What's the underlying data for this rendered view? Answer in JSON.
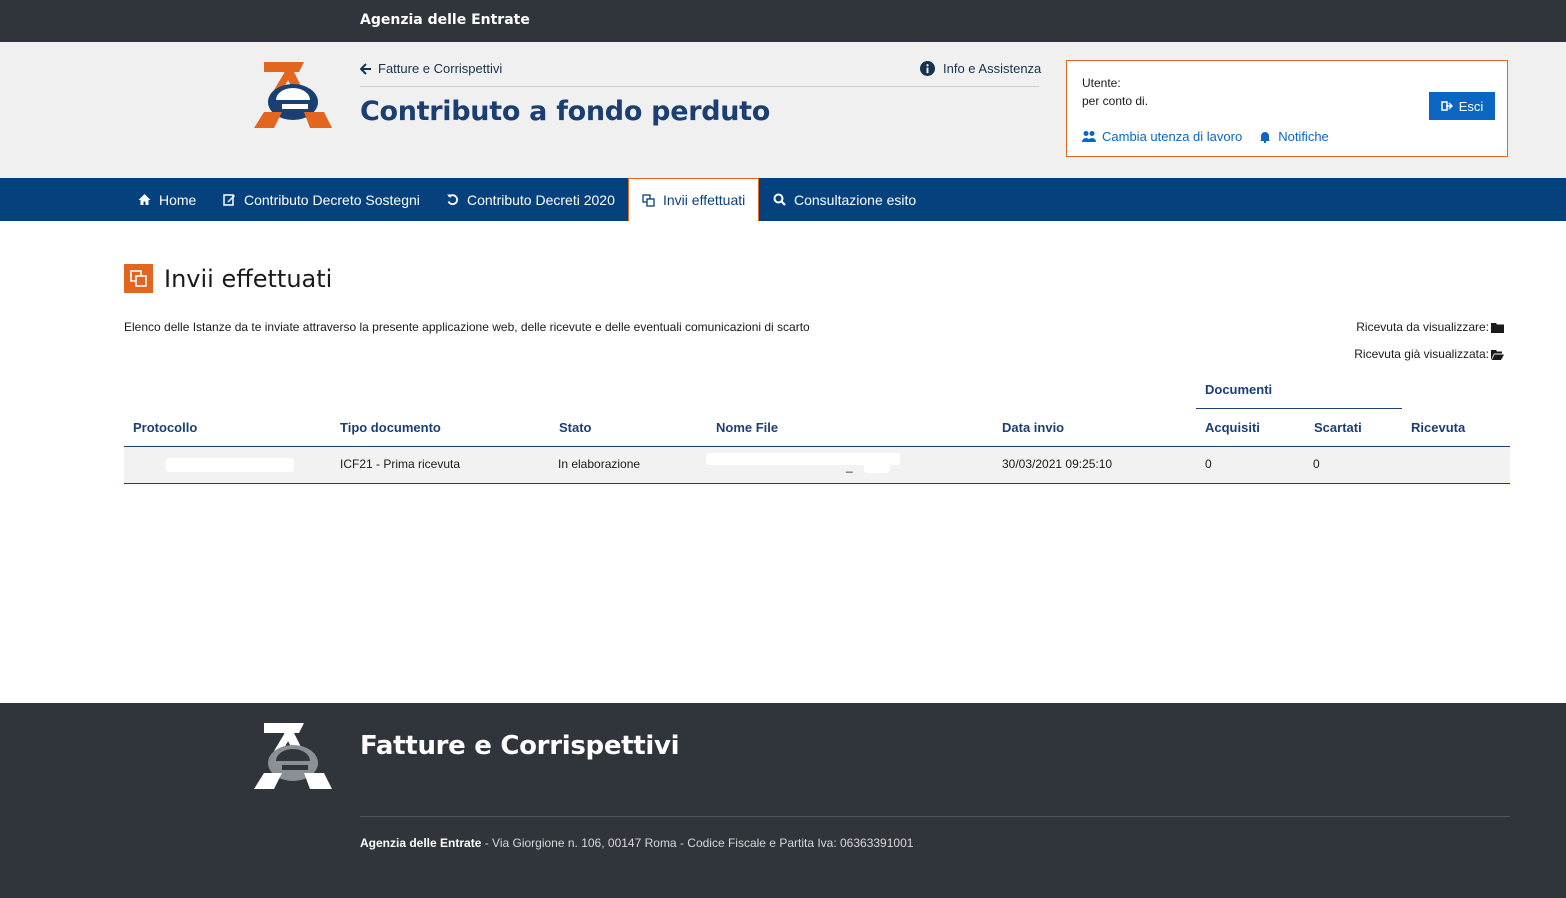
{
  "topbar": {
    "agency": "Agenzia delle Entrate"
  },
  "header": {
    "back_link": "Fatture e Corrispettivi",
    "info_link": "Info e Assistenza",
    "title": "Contributo a fondo perduto"
  },
  "user": {
    "utente_label": "Utente:",
    "per_conto": "per conto di.",
    "logout": "Esci",
    "change_workspace": "Cambia utenza di lavoro",
    "notifications": "Notifiche"
  },
  "nav": {
    "items": [
      {
        "label": "Home",
        "icon": "home-icon"
      },
      {
        "label": "Contributo Decreto Sostegni",
        "icon": "edit-icon"
      },
      {
        "label": "Contributo Decreti 2020",
        "icon": "undo-icon"
      },
      {
        "label": "Invii effettuati",
        "icon": "copy-icon",
        "active": true
      },
      {
        "label": "Consultazione esito",
        "icon": "search-icon"
      }
    ]
  },
  "page": {
    "title": "Invii effettuati",
    "description": "Elenco delle Istanze da te inviate attraverso la presente applicazione web, delle ricevute e delle eventuali comunicazioni di scarto",
    "legend_unread": "Ricevuta da visualizzare:",
    "legend_read": "Ricevuta già visualizzata:"
  },
  "table": {
    "group_header": "Documenti",
    "columns": [
      "Protocollo",
      "Tipo documento",
      "Stato",
      "Nome File",
      "Data invio",
      "Acquisiti",
      "Scartati",
      "Ricevuta"
    ],
    "rows": [
      {
        "protocollo": "",
        "tipo": "ICF21 - Prima ricevuta",
        "stato": "In elaborazione",
        "nome_file": "_",
        "data_invio": "30/03/2021 09:25:10",
        "acquisiti": "0",
        "scartati": "0",
        "ricevuta": ""
      }
    ]
  },
  "footer": {
    "title": "Fatture e Corrispettivi",
    "agency": "Agenzia delle Entrate",
    "address": " - Via Giorgione n. 106, 00147 Roma - Codice Fiscale e Partita Iva: 06363391001"
  },
  "colors": {
    "dark_bar": "#30353b",
    "nav_blue": "#05417d",
    "title_blue": "#1b3f73",
    "accent_orange": "#e3661f",
    "button_blue": "#0b66c3"
  }
}
